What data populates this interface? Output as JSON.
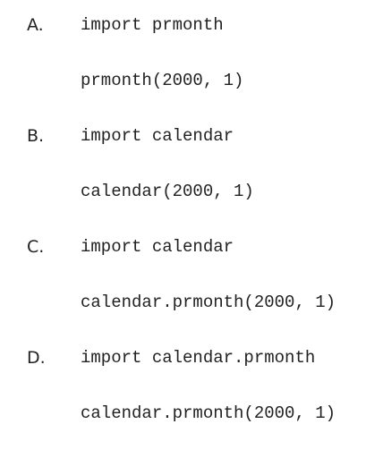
{
  "options": [
    {
      "letter": "A.",
      "lines": [
        "import prmonth",
        "prmonth(2000, 1)"
      ]
    },
    {
      "letter": "B.",
      "lines": [
        "import calendar",
        "calendar(2000, 1)"
      ]
    },
    {
      "letter": "C.",
      "lines": [
        "import calendar",
        "calendar.prmonth(2000, 1)"
      ]
    },
    {
      "letter": "D.",
      "lines": [
        "import calendar.prmonth",
        "calendar.prmonth(2000, 1)"
      ]
    }
  ]
}
